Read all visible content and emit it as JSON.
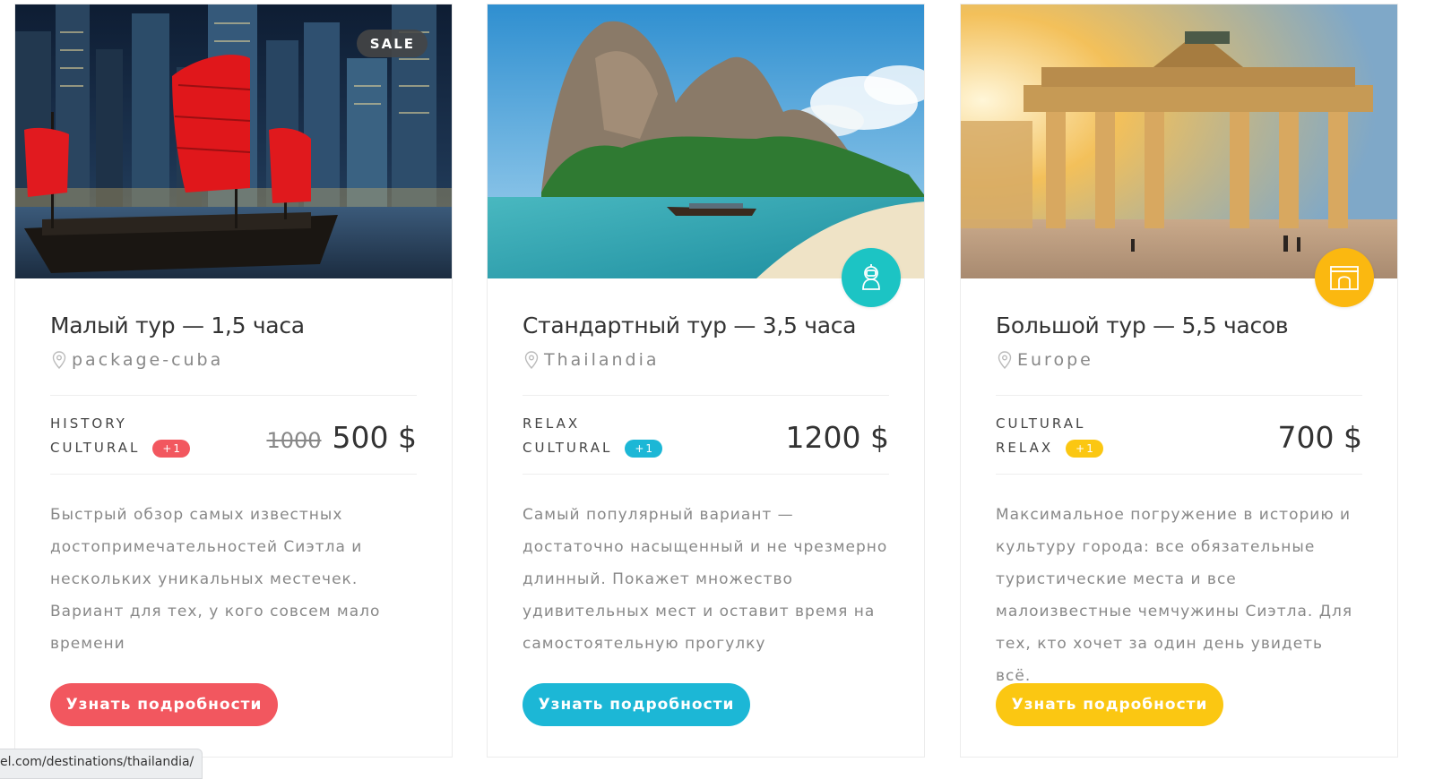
{
  "cards": [
    {
      "sale_badge": "SALE",
      "title": "Малый тур — 1,5 часа",
      "location": "package-cuba",
      "tags": [
        "HISTORY",
        "CULTURAL"
      ],
      "plus_badge": "+1",
      "price_old": "1000",
      "price": "500 $",
      "description": "Быстрый обзор самых известных достопримечательностей Сиэтла и нескольких уникальных местечек. Вариант для тех, у кого совсем мало времени",
      "button": "Узнать подробности",
      "accent": "#f2575f"
    },
    {
      "category_icon": "diver-icon",
      "title": "Стандартный тур — 3,5 часа",
      "location": "Thailandia",
      "tags": [
        "RELAX",
        "CULTURAL"
      ],
      "plus_badge": "+1",
      "price": "1200 $",
      "description": "Самый популярный вариант — достаточно насыщенный и не чрезмерно длинный. Покажет множество удивительных мест и оставит время на самостоятельную прогулку",
      "button": "Узнать подробности",
      "accent": "#1cb7d6"
    },
    {
      "category_icon": "arch-monument-icon",
      "title": "Большой тур — 5,5 часов",
      "location": "Europe",
      "tags": [
        "CULTURAL",
        "RELAX"
      ],
      "plus_badge": "+1",
      "price": "700 $",
      "description": "Максимальное погружение в историю и культуру города: все обязательные туристические места и все малоизвестные чемчужины Сиэтла. Для тех, кто хочет за один день увидеть всё.",
      "button": "Узнать подробности",
      "accent": "#fbc712"
    }
  ],
  "status_url": "el.com/destinations/thailandia/"
}
